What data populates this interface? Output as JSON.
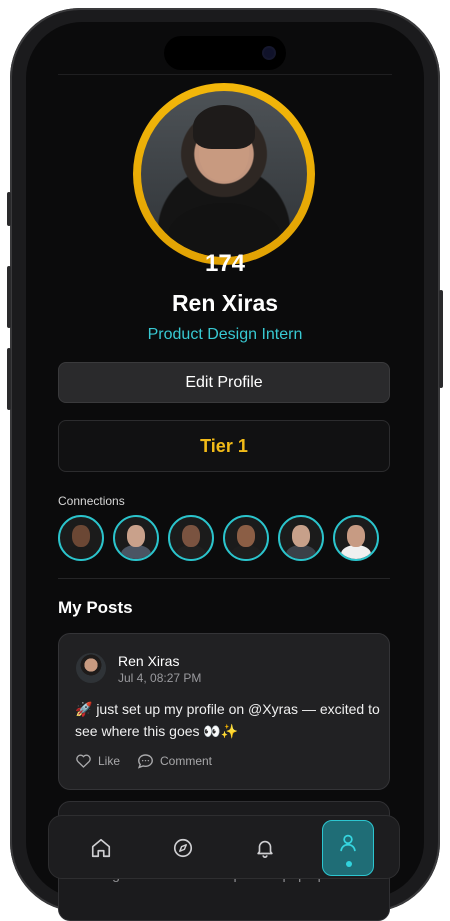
{
  "profile": {
    "score": "174",
    "name": "Ren Xiras",
    "title": "Product Design Intern",
    "edit_label": "Edit Profile",
    "tier_label": "Tier 1",
    "ring_color": "#F2B50A"
  },
  "connections": {
    "label": "Connections",
    "items": [
      "connection-avatar-1",
      "connection-avatar-2",
      "connection-avatar-3",
      "connection-avatar-4",
      "connection-avatar-5",
      "connection-avatar-6"
    ],
    "accent": "#2BC4CC"
  },
  "posts": {
    "section_title": "My Posts",
    "items": [
      {
        "author": "Ren Xiras",
        "time": "Jul 4, 08:27 PM",
        "text": "🚀 just set up my profile on @Xyras — excited to see where this goes 👀✨",
        "like_label": "Like",
        "comment_label": "Comment"
      },
      {
        "peek_text": "starting to see some cool profiles pop up here"
      }
    ]
  },
  "tabs": {
    "items": [
      {
        "icon": "home-icon",
        "active": false
      },
      {
        "icon": "compass-icon",
        "active": false
      },
      {
        "icon": "bell-icon",
        "active": false
      },
      {
        "icon": "profile-icon",
        "active": true
      }
    ]
  }
}
